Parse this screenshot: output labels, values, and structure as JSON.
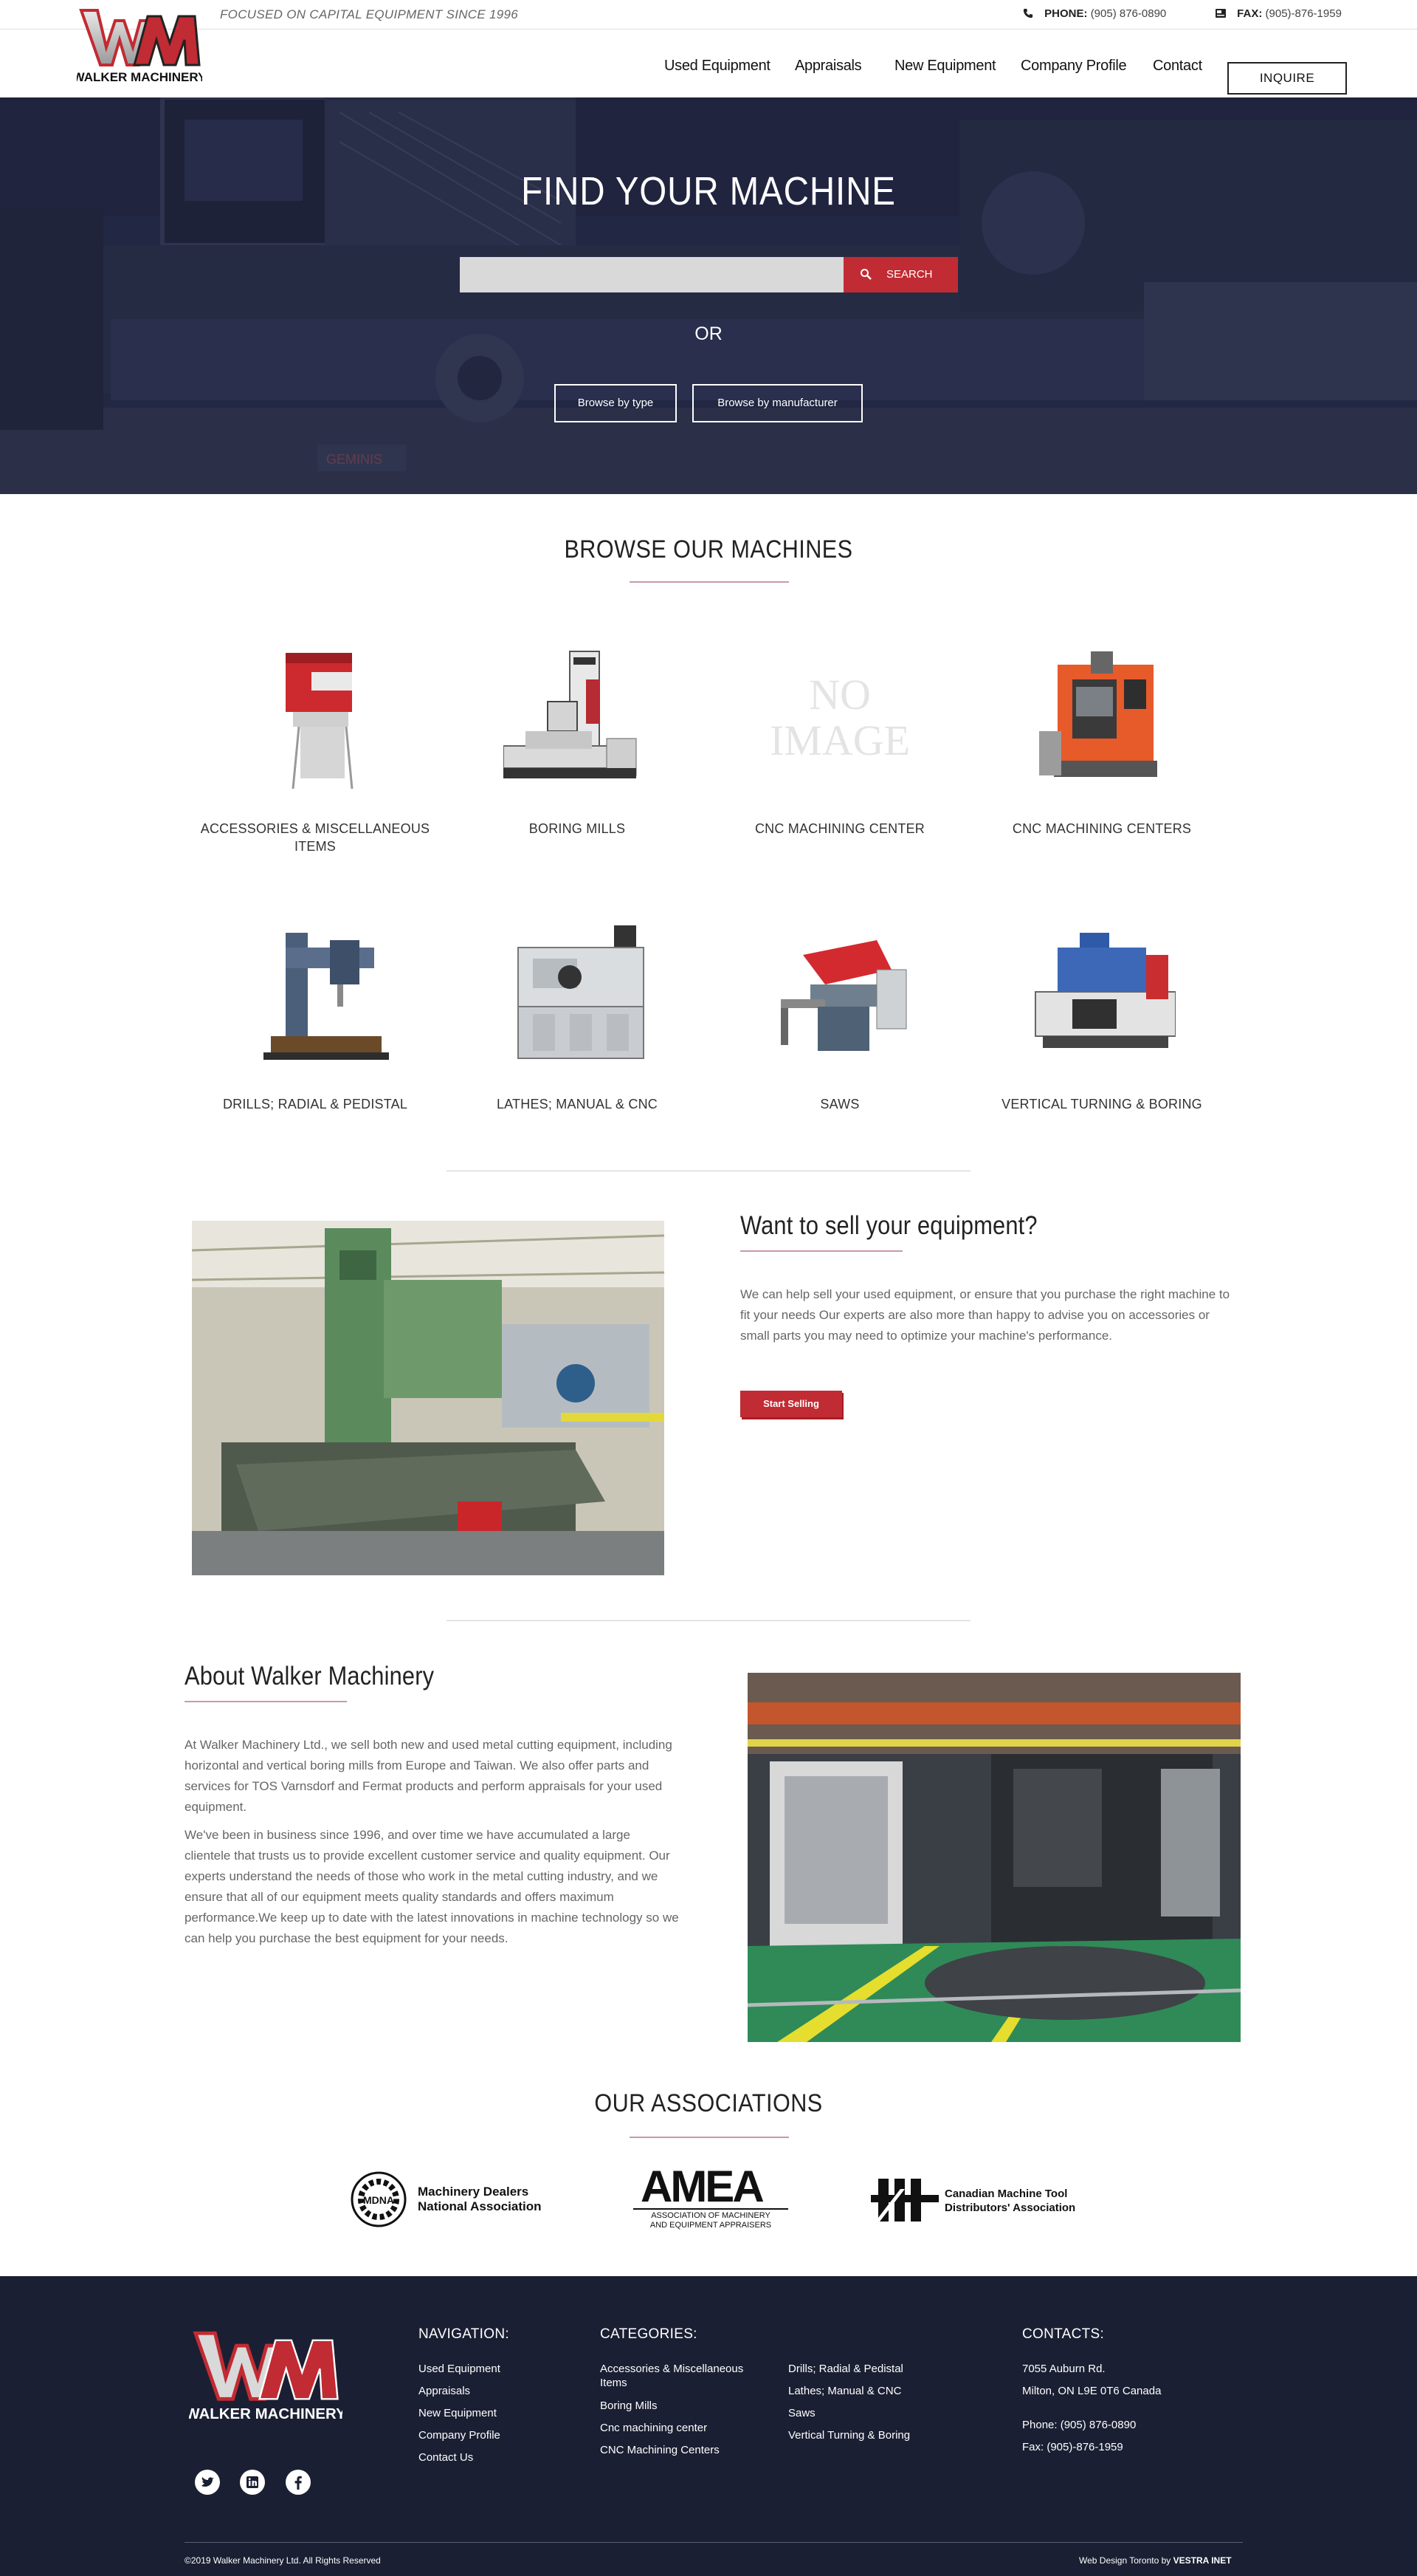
{
  "topbar": {
    "tagline": "FOCUSED ON CAPITAL EQUIPMENT SINCE 1996",
    "phone_label": "PHONE:",
    "phone_value": "(905) 876-0890",
    "fax_label": "FAX:",
    "fax_value": "(905)-876-1959"
  },
  "brand": {
    "name": "WALKER MACHINERY",
    "monogram": "WM",
    "accent": "#c12b33"
  },
  "nav": {
    "items": [
      "Used Equipment",
      "Appraisals",
      "New Equipment",
      "Company Profile",
      "Contact"
    ],
    "cta": "INQUIRE"
  },
  "hero": {
    "title": "FIND YOUR MACHINE",
    "search_placeholder": "",
    "search_button": "SEARCH",
    "or": "OR",
    "browse_type": "Browse by type",
    "browse_manufacturer": "Browse by manufacturer",
    "machine_badge": "GEMINIS"
  },
  "browse": {
    "title": "BROWSE OUR MACHINES",
    "categories": [
      {
        "label": "ACCESSORIES & MISCELLANEOUS ITEMS",
        "image": "accessory-machine"
      },
      {
        "label": "BORING MILLS",
        "image": "boring-mill"
      },
      {
        "label": "CNC MACHINING CENTER",
        "image": "no-image",
        "placeholder": "NO IMAGE"
      },
      {
        "label": "CNC MACHINING CENTERS",
        "image": "cnc-center"
      },
      {
        "label": "DRILLS; RADIAL & PEDISTAL",
        "image": "radial-drill"
      },
      {
        "label": "LATHES; MANUAL & CNC",
        "image": "lathe"
      },
      {
        "label": "SAWS",
        "image": "band-saw"
      },
      {
        "label": "VERTICAL TURNING & BORING",
        "image": "vertical-turning"
      }
    ]
  },
  "sell": {
    "title": "Want to sell your equipment?",
    "text": "We can help sell your used equipment, or ensure that you purchase the right machine to fit your needs  Our experts are also more than happy to advise you on accessories or small parts you may need to optimize your machine's performance.",
    "button": "Start Selling"
  },
  "about": {
    "title": "About Walker Machinery",
    "p1": "At Walker Machinery Ltd., we sell both new and used metal cutting equipment, including horizontal and vertical boring mills from Europe and Taiwan. We also offer parts and services for TOS Varnsdorf and Fermat products and perform appraisals for your used equipment.",
    "p2": "We've been in business since 1996, and over time we have accumulated a large clientele that trusts us to provide excellent customer service and quality equipment. Our experts understand the needs of those who work in the metal cutting industry, and we ensure that all of our equipment meets quality standards and offers maximum performance.We keep up to date with the latest innovations in machine technology so we can help you purchase the best equipment for your needs."
  },
  "associations": {
    "title": "OUR ASSOCIATIONS",
    "mdna_line1": "Machinery Dealers",
    "mdna_line2": "National Association",
    "mdna_mark": "MDNA",
    "amea_mark": "AMEA",
    "amea_line1": "ASSOCIATION OF MACHINERY",
    "amea_line2": "AND EQUIPMENT APPRAISERS",
    "cmtda_line1": "Canadian Machine Tool",
    "cmtda_line2": "Distributors' Association"
  },
  "footer": {
    "nav_title": "NAVIGATION:",
    "nav_links": [
      "Used Equipment",
      "Appraisals",
      "New Equipment",
      "Company Profile",
      "Contact Us"
    ],
    "cat_title": "CATEGORIES:",
    "cat_col1": [
      "Accessories & Miscellaneous Items",
      "Boring Mills",
      "Cnc machining center",
      "CNC Machining Centers"
    ],
    "cat_col2": [
      "Drills; Radial & Pedistal",
      "Lathes; Manual & CNC",
      "Saws",
      "Vertical Turning & Boring"
    ],
    "contacts_title": "CONTACTS:",
    "address1": "7055 Auburn Rd.",
    "address2": "Milton, ON L9E 0T6 Canada",
    "phone": "Phone: (905) 876-0890",
    "fax": "Fax: (905)-876-1959",
    "copyright": "©2019 Walker Machinery Ltd. All Rights Reserved",
    "credit_prefix": "Web Design Toronto by",
    "credit_brand": "VESTRA INET"
  }
}
